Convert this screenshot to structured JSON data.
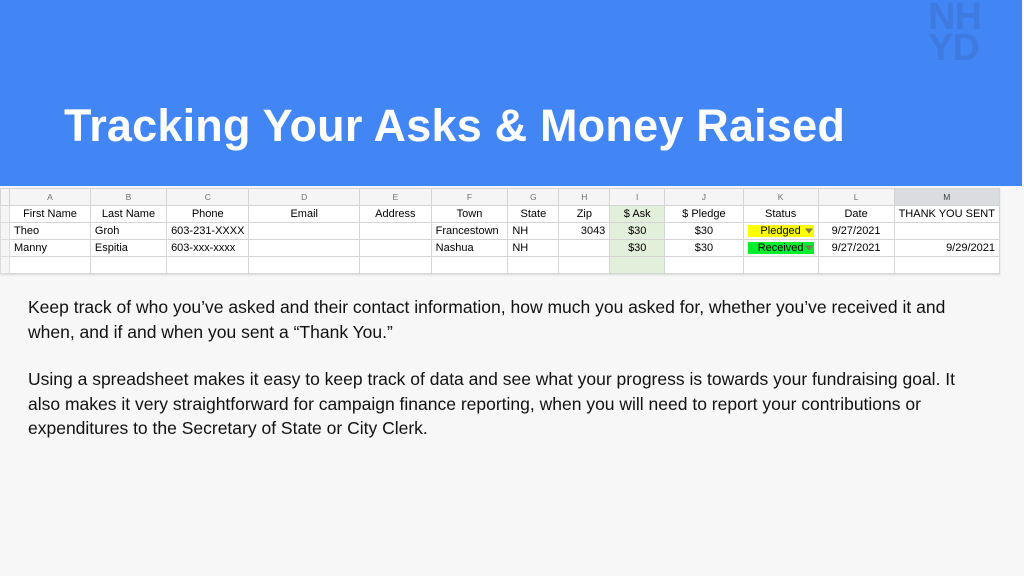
{
  "theme": {
    "band_color": "#4285f4",
    "page_background": "#f7f7f7",
    "title_color": "#ffffff",
    "ask_column_tint": "#e2efda",
    "status_pledged_color": "#ffff00",
    "status_received_color": "#00ee2e"
  },
  "header": {
    "title": "Tracking Your Asks & Money Raised",
    "logo_line1": "NH",
    "logo_line2": "YD"
  },
  "spreadsheet": {
    "column_letters": [
      "A",
      "B",
      "C",
      "D",
      "E",
      "F",
      "G",
      "H",
      "I",
      "J",
      "K",
      "L",
      "M"
    ],
    "selected_column_letter": "M",
    "field_headers": [
      "First Name",
      "Last Name",
      "Phone",
      "Email",
      "Address",
      "Town",
      "State",
      "Zip",
      "$ Ask",
      "$ Pledge",
      "Status",
      "Date",
      "THANK YOU SENT"
    ],
    "rows": [
      {
        "first_name": "Theo",
        "last_name": "Groh",
        "phone": "603-231-XXXX",
        "email": "",
        "address": "",
        "town": "Francestown",
        "state": "NH",
        "zip": "3043",
        "ask": "$30",
        "pledge": "$30",
        "status": "Pledged",
        "date": "9/27/2021",
        "thank_you_sent": ""
      },
      {
        "first_name": "Manny",
        "last_name": "Espitia",
        "phone": "603-xxx-xxxx",
        "email": "",
        "address": "",
        "town": "Nashua",
        "state": "NH",
        "zip": "",
        "ask": "$30",
        "pledge": "$30",
        "status": "Received",
        "date": "9/27/2021",
        "thank_you_sent": "9/29/2021"
      }
    ]
  },
  "body": {
    "paragraph_1": "Keep track of who you’ve asked and their contact information, how much you asked for, whether you’ve received it and when, and if and when you sent a “Thank You.”",
    "paragraph_2": "Using a spreadsheet makes it easy to keep track of data and see what your progress is towards your fundraising goal. It also makes it very straightforward for campaign finance reporting, when you will need to report your contributions or expenditures to the Secretary of State or City Clerk."
  }
}
